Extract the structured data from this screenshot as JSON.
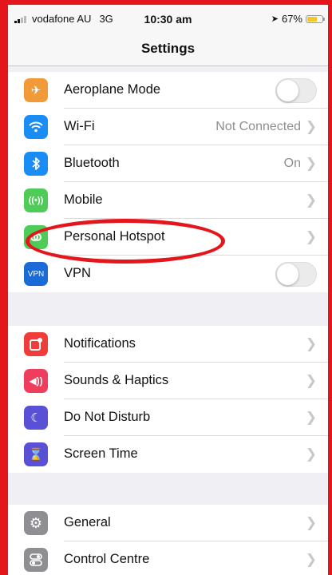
{
  "status": {
    "carrier": "vodafone AU",
    "network": "3G",
    "time": "10:30 am",
    "battery": "67%",
    "battery_level": 0.67
  },
  "nav": {
    "title": "Settings"
  },
  "groups": [
    {
      "rows": [
        {
          "label": "Aeroplane Mode",
          "icon": "airplane-icon",
          "color": "#f29a38",
          "toggle": false
        },
        {
          "label": "Wi-Fi",
          "icon": "wifi-icon",
          "color": "#1a8cf5",
          "value": "Not Connected"
        },
        {
          "label": "Bluetooth",
          "icon": "bluetooth-icon",
          "color": "#1a8cf5",
          "value": "On"
        },
        {
          "label": "Mobile",
          "icon": "antenna-icon",
          "color": "#4fcb57",
          "value": ""
        },
        {
          "label": "Personal Hotspot",
          "icon": "hotspot-icon",
          "color": "#4fcb57",
          "value": ""
        },
        {
          "label": "VPN",
          "icon": "vpn-icon",
          "icon_text": "VPN",
          "color": "#1a6bd8",
          "toggle": false
        }
      ]
    },
    {
      "rows": [
        {
          "label": "Notifications",
          "icon": "notifications-icon",
          "color": "#ef3e3a"
        },
        {
          "label": "Sounds & Haptics",
          "icon": "speaker-icon",
          "color": "#ef3d5e"
        },
        {
          "label": "Do Not Disturb",
          "icon": "moon-icon",
          "color": "#5a50d6"
        },
        {
          "label": "Screen Time",
          "icon": "hourglass-icon",
          "color": "#5a50d6"
        }
      ]
    },
    {
      "rows": [
        {
          "label": "General",
          "icon": "gear-icon",
          "color": "#8e8e93"
        },
        {
          "label": "Control Centre",
          "icon": "switches-icon",
          "color": "#8e8e93"
        }
      ]
    }
  ],
  "colors": {
    "highlight": "#e4161c",
    "background": "#efeff4",
    "chevron": "#c7c7cc"
  }
}
